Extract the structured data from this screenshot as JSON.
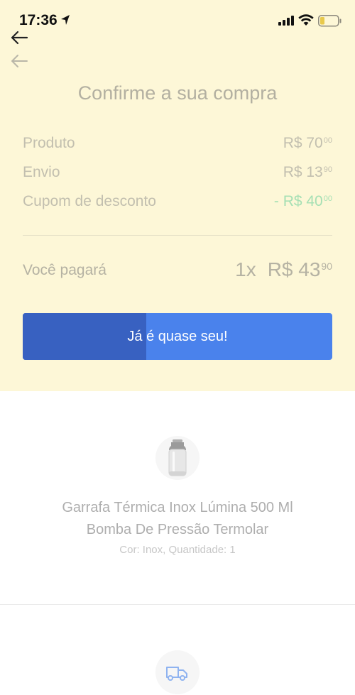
{
  "status_bar": {
    "time": "17:36",
    "icons": [
      "location-arrow-icon",
      "signal-bars-icon",
      "wifi-icon",
      "battery-low-icon"
    ],
    "battery_color": "#e8c94c"
  },
  "nav": {
    "icons": [
      "back-arrow-icon",
      "back-arrow-faded-icon"
    ]
  },
  "page": {
    "title": "Confirme a sua compra"
  },
  "summary": {
    "rows": [
      {
        "label": "Produto",
        "value": "R$ 70",
        "cents": "00"
      },
      {
        "label": "Envio",
        "value": "R$ 13",
        "cents": "90"
      },
      {
        "label": "Cupom de desconto",
        "value": "- R$ 40",
        "cents": "00"
      }
    ],
    "total": {
      "label": "Você pagará",
      "installments": "1x",
      "value": "R$ 43",
      "cents": "90"
    }
  },
  "cta": {
    "label": "Já é quase seu!",
    "progress_fraction": 0.4,
    "color": "#4a82ec",
    "progress_color": "#3861c1"
  },
  "product": {
    "name_line1": "Garrafa Térmica Inox Lúmina 500 Ml",
    "name_line2": "Bomba De Pressão Termolar",
    "attributes": "Cor: Inox, Quantidade: 1",
    "icon": "thermos-bottle-image"
  },
  "shipping": {
    "icon": "truck-icon"
  },
  "colors": {
    "background_top": "#fdf7d7",
    "discount_green": "#a6e0b4"
  }
}
